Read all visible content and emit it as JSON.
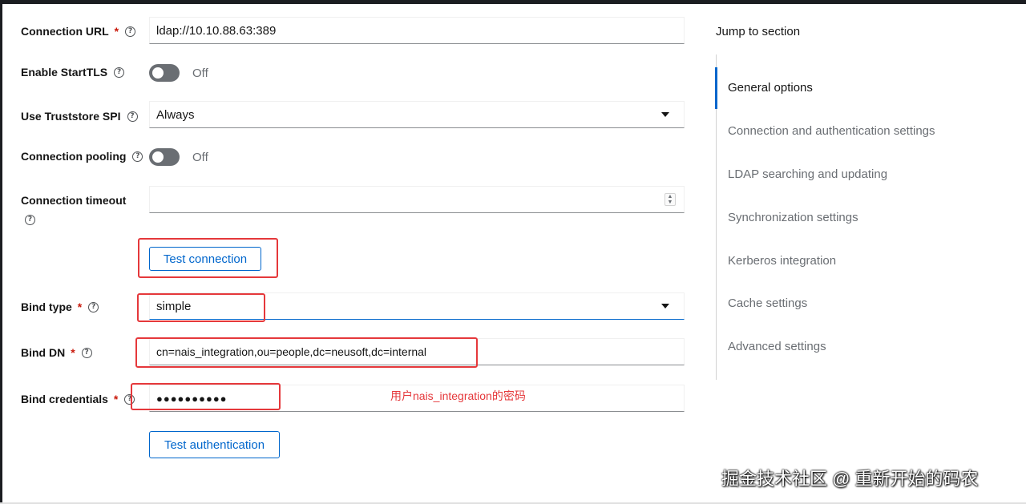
{
  "form": {
    "connection_url": {
      "label": "Connection URL",
      "required": "*",
      "value": "ldap://10.10.88.63:389"
    },
    "enable_starttls": {
      "label": "Enable StartTLS",
      "state": "Off"
    },
    "use_truststore_spi": {
      "label": "Use Truststore SPI",
      "selected": "Always"
    },
    "connection_pooling": {
      "label": "Connection pooling",
      "state": "Off"
    },
    "connection_timeout": {
      "label": "Connection timeout",
      "value": ""
    },
    "test_connection_label": "Test connection",
    "bind_type": {
      "label": "Bind type",
      "required": "*",
      "selected": "simple"
    },
    "bind_dn": {
      "label": "Bind DN",
      "required": "*",
      "value": "cn=nais_integration,ou=people,dc=neusoft,dc=internal"
    },
    "bind_credentials": {
      "label": "Bind credentials",
      "required": "*",
      "value": "●●●●●●●●●●"
    },
    "test_authentication_label": "Test authentication",
    "help_glyph": "?"
  },
  "annotation": {
    "text": "用户nais_integration的密码",
    "color": "#e5383b"
  },
  "jump_nav": {
    "title": "Jump to section",
    "items": [
      "General options",
      "Connection and authentication settings",
      "LDAP searching and updating",
      "Synchronization settings",
      "Kerberos integration",
      "Cache settings",
      "Advanced settings"
    ],
    "active_index": 0
  },
  "watermark": "掘金技术社区 @ 重新开始的码农",
  "colors": {
    "accent": "#0066cc",
    "required": "#c9190b",
    "highlight": "#e5383b",
    "toggle_off": "#6a6e73"
  },
  "icons": {
    "help": "help-circle-icon",
    "dropdown": "caret-down-icon",
    "spinner": "number-spinner-icon"
  }
}
